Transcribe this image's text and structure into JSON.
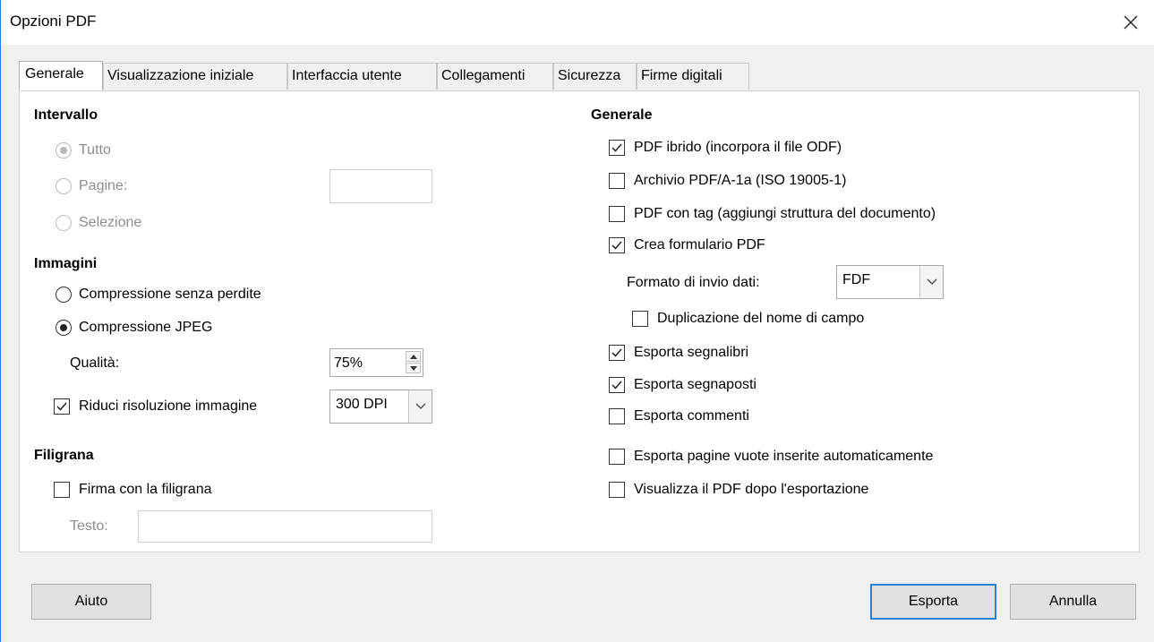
{
  "window": {
    "title": "Opzioni PDF"
  },
  "tabs": [
    {
      "label": "Generale"
    },
    {
      "label": "Visualizzazione iniziale"
    },
    {
      "label": "Interfaccia utente"
    },
    {
      "label": "Collegamenti"
    },
    {
      "label": "Sicurezza"
    },
    {
      "label": "Firme digitali"
    }
  ],
  "range": {
    "heading": "Intervallo",
    "all": {
      "label": "Tutto",
      "selected": true
    },
    "pages": {
      "label": "Pagine:",
      "value": ""
    },
    "selection": {
      "label": "Selezione"
    }
  },
  "images": {
    "heading": "Immagini",
    "lossless": {
      "label": "Compressione senza perdite",
      "selected": false
    },
    "jpeg": {
      "label": "Compressione JPEG",
      "selected": true
    },
    "quality": {
      "label": "Qualità:",
      "value": "75%"
    },
    "reduce": {
      "label": "Riduci risoluzione immagine",
      "checked": true,
      "value": "300 DPI"
    }
  },
  "watermark": {
    "heading": "Filigrana",
    "sign": {
      "label": "Firma con la filigrana",
      "checked": false
    },
    "text": {
      "label": "Testo:",
      "value": ""
    }
  },
  "general": {
    "heading": "Generale",
    "hybrid": {
      "label": "PDF ibrido (incorpora il file ODF)",
      "checked": true
    },
    "archive": {
      "label": "Archivio PDF/A-1a (ISO 19005-1)",
      "checked": false
    },
    "tagged": {
      "label": "PDF con tag (aggiungi struttura del documento)",
      "checked": false
    },
    "form": {
      "label": "Crea formulario PDF",
      "checked": true
    },
    "submit_format": {
      "label": "Formato di invio dati:",
      "value": "FDF"
    },
    "dup_names": {
      "label": "Duplicazione del nome di campo",
      "checked": false
    },
    "bookmarks": {
      "label": "Esporta segnalibri",
      "checked": true
    },
    "placeholders": {
      "label": "Esporta segnaposti",
      "checked": true
    },
    "comments": {
      "label": "Esporta commenti",
      "checked": false
    },
    "blank_pages": {
      "label": "Esporta pagine vuote inserite automaticamente",
      "checked": false
    },
    "view_after": {
      "label": "Visualizza il PDF dopo l'esportazione",
      "checked": false
    }
  },
  "buttons": {
    "help": "Aiuto",
    "export": "Esporta",
    "cancel": "Annulla"
  }
}
